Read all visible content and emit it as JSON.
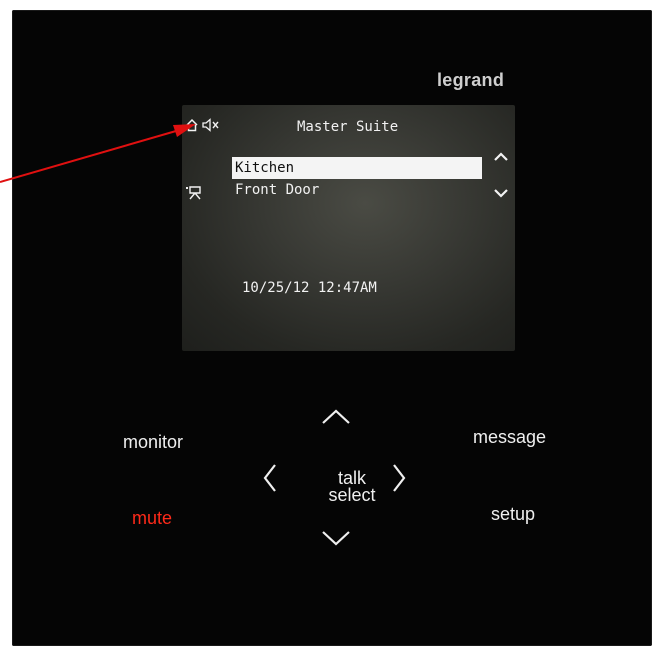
{
  "device": {
    "brand": "legrand"
  },
  "screen": {
    "title": "Master Suite",
    "list": [
      {
        "label": "Kitchen",
        "selected": true
      },
      {
        "label": "Front Door",
        "selected": false
      }
    ],
    "datetime": "10/25/12 12:47AM",
    "icons": [
      "home-icon",
      "speaker-muted-icon",
      "scroll-up-icon",
      "scroll-down-icon",
      "door-camera-icon"
    ]
  },
  "buttons": {
    "monitor": "monitor",
    "message": "message",
    "mute": "mute",
    "setup": "setup",
    "talk": "talk",
    "select": "select"
  },
  "colors": {
    "panel": "#050505",
    "mute": "#ff2a1a",
    "annotation_arrow": "#e01010"
  }
}
